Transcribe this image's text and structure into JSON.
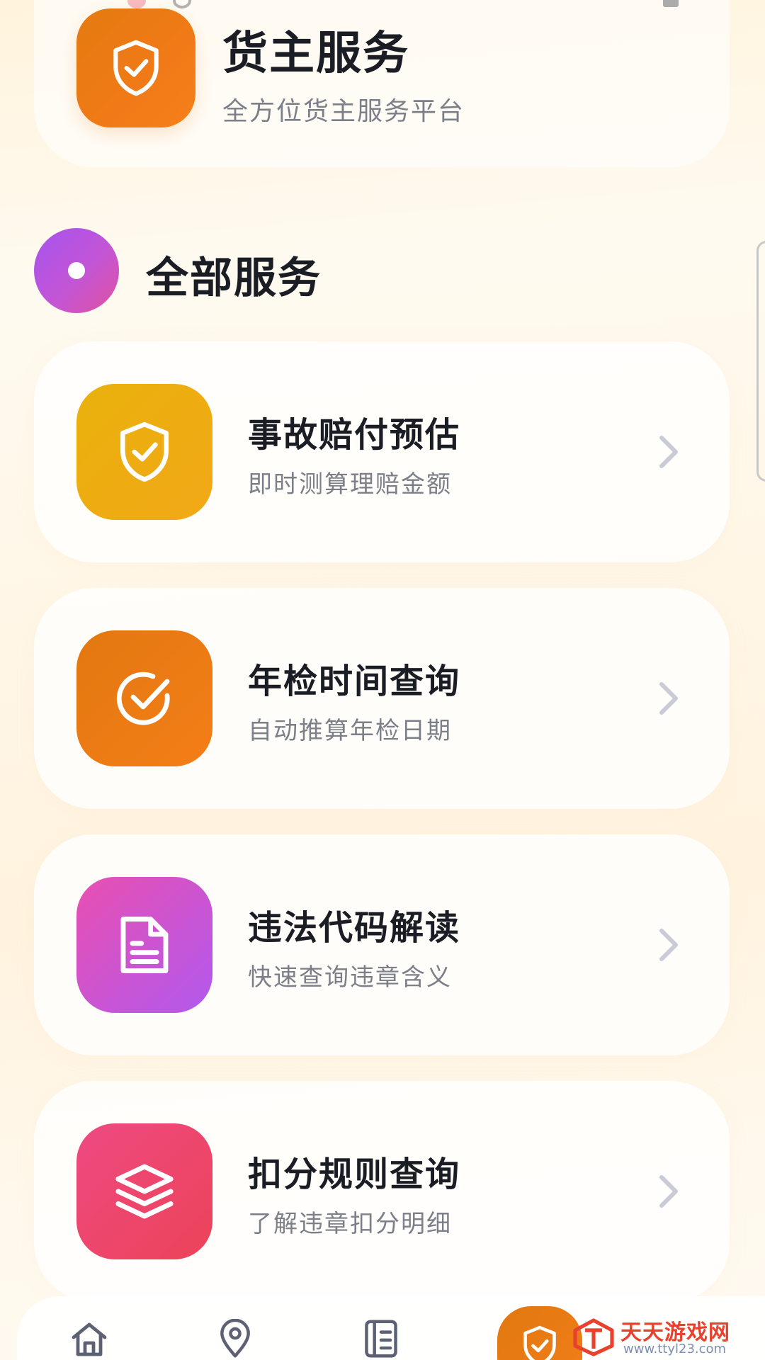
{
  "header": {
    "title": "货主服务",
    "subtitle": "全方位货主服务平台",
    "icon": "shield-check-icon"
  },
  "section": {
    "title": "全部服务"
  },
  "services": [
    {
      "title": "事故赔付预估",
      "subtitle": "即时测算理赔金额",
      "icon": "shield-check-icon",
      "color_from": "#e9b10c",
      "color_to": "#f2a817"
    },
    {
      "title": "年检时间查询",
      "subtitle": "自动推算年检日期",
      "icon": "circle-check-icon",
      "color_from": "#e37810",
      "color_to": "#f47e18"
    },
    {
      "title": "违法代码解读",
      "subtitle": "快速查询违章含义",
      "icon": "document-icon",
      "color_from": "#e84fb1",
      "color_to": "#b259ee"
    },
    {
      "title": "扣分规则查询",
      "subtitle": "了解违章扣分明细",
      "icon": "layers-icon",
      "color_from": "#ee4a82",
      "color_to": "#ec4358"
    }
  ],
  "bottom_nav": [
    {
      "name": "home",
      "icon": "home-icon"
    },
    {
      "name": "location",
      "icon": "map-pin-icon"
    },
    {
      "name": "list",
      "icon": "document-list-icon"
    },
    {
      "name": "services",
      "icon": "shield-check-icon",
      "active": true
    }
  ],
  "watermark": {
    "text": "天天游戏网",
    "url": "www.ttyl23.com"
  }
}
